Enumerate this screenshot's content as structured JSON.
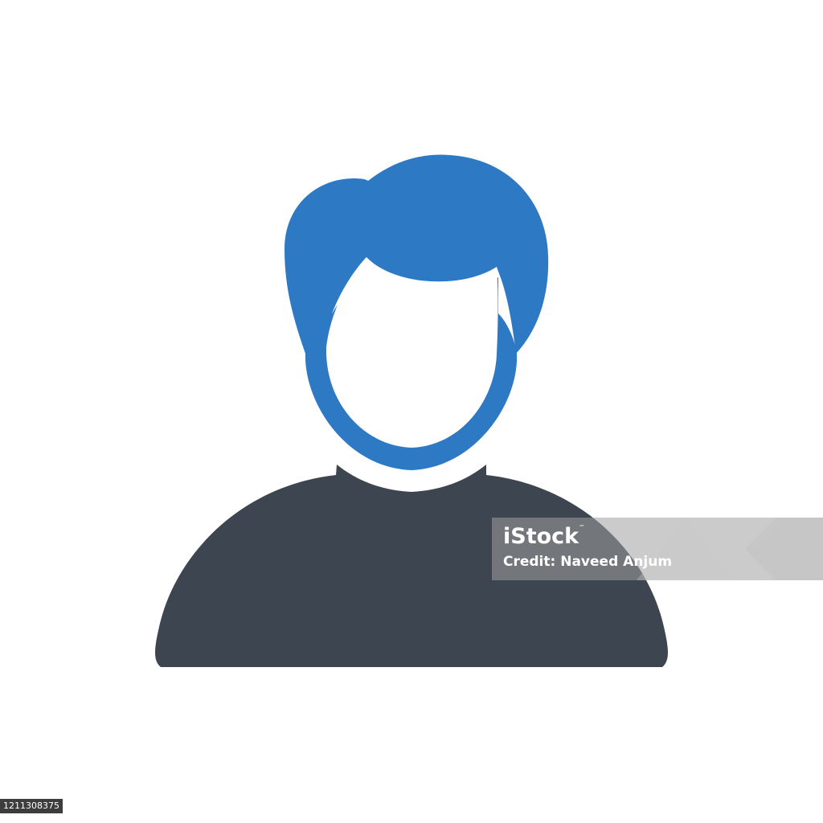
{
  "icon": {
    "name": "user-avatar-icon",
    "hair_color": "#2d79c3",
    "body_color": "#3d4650",
    "face_color": "#ffffff"
  },
  "watermark": {
    "logo": "iStock",
    "tm": "™",
    "credit": "Credit: Naveed Anjum"
  },
  "image_id": "1211308375"
}
